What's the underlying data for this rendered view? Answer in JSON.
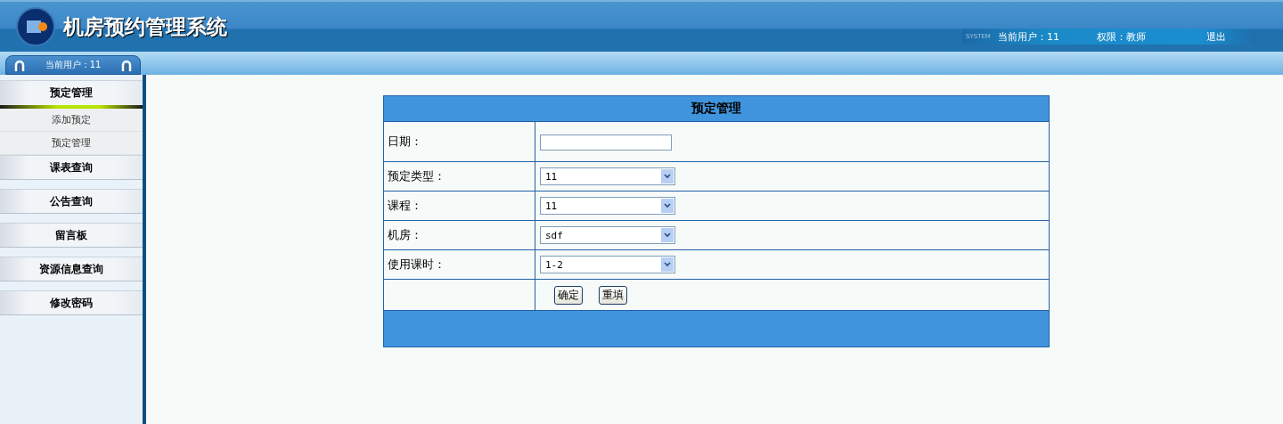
{
  "header": {
    "title": "机房预约管理系统",
    "badge": "SYSTEM",
    "current_user": "当前用户：11",
    "role": "权限：教师",
    "logout": "退出"
  },
  "subbar": {
    "user_tab": "当前用户：11"
  },
  "sidebar": {
    "groups": [
      {
        "label": "预定管理",
        "expanded": true,
        "items": [
          "添加预定",
          "预定管理"
        ]
      },
      {
        "label": "课表查询",
        "expanded": false
      },
      {
        "label": "公告查询",
        "expanded": false
      },
      {
        "label": "留言板",
        "expanded": false
      },
      {
        "label": "资源信息查询",
        "expanded": false
      },
      {
        "label": "修改密码",
        "expanded": false
      }
    ]
  },
  "form": {
    "title": "预定管理",
    "fields": [
      {
        "label": "日期：",
        "kind": "text"
      },
      {
        "label": "预定类型：",
        "kind": "select",
        "value": "11"
      },
      {
        "label": "课程：",
        "kind": "select",
        "value": "11"
      },
      {
        "label": "机房：",
        "kind": "select",
        "value": "sdf"
      },
      {
        "label": "使用课时：",
        "kind": "select",
        "value": "1-2"
      }
    ],
    "buttons": [
      "确定",
      "重填"
    ]
  }
}
